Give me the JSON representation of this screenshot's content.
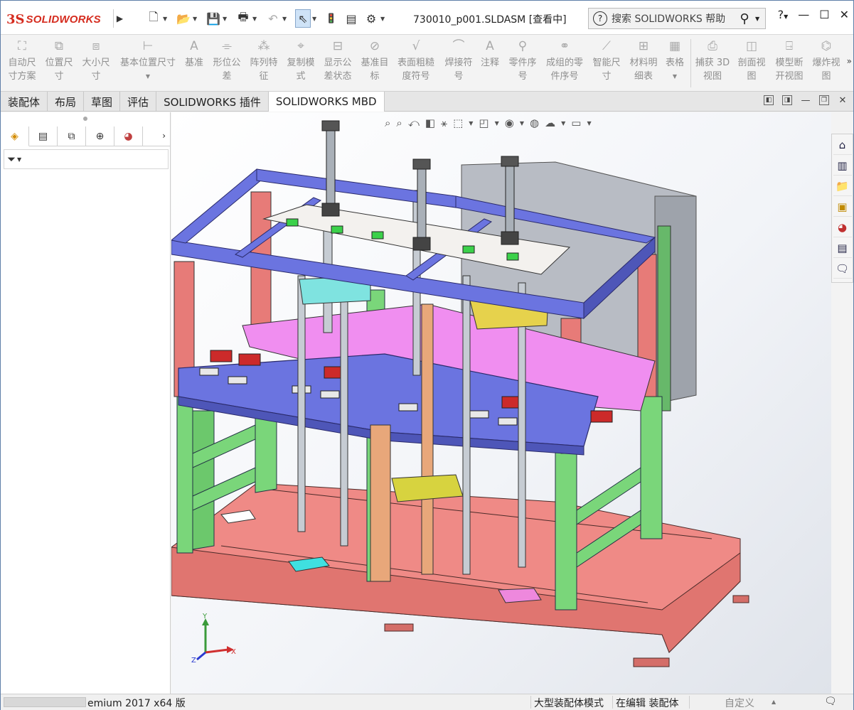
{
  "app": {
    "logo_ds": "3S",
    "logo_solid": "SOLID",
    "logo_works": "WORKS",
    "document_title": "730010_p001.SLDASM [查看中]",
    "search_placeholder": "搜索 SOLIDWORKS 帮助",
    "help_label": "?",
    "accent_color": "#d52b1e"
  },
  "quick_access": [
    {
      "name": "new-icon",
      "glyph": "🗋"
    },
    {
      "name": "open-icon",
      "glyph": "📂"
    },
    {
      "name": "save-icon",
      "glyph": "💾"
    },
    {
      "name": "print-icon",
      "glyph": "🖶"
    },
    {
      "name": "undo-icon",
      "glyph": "↶"
    },
    {
      "name": "select-icon",
      "glyph": "⇖"
    },
    {
      "name": "rebuild-icon",
      "glyph": "🚦"
    },
    {
      "name": "file-properties-icon",
      "glyph": "▤"
    },
    {
      "name": "options-icon",
      "glyph": "⚙"
    }
  ],
  "commands": [
    {
      "label": "自动尺\n寸方案",
      "icon": "auto-dimension-icon",
      "glyph": "⛶"
    },
    {
      "label": "位置尺\n寸",
      "icon": "location-dimension-icon",
      "glyph": "⧉"
    },
    {
      "label": "大小尺\n寸",
      "icon": "size-dimension-icon",
      "glyph": "⧈"
    },
    {
      "label": "基本位置尺寸",
      "icon": "basic-location-dimension-icon",
      "glyph": "⊢"
    },
    {
      "label": "基准",
      "icon": "datum-icon",
      "glyph": "A"
    },
    {
      "label": "形位公\n差",
      "icon": "geometric-tolerance-icon",
      "glyph": "⌯"
    },
    {
      "label": "阵列特\n征",
      "icon": "pattern-feature-icon",
      "glyph": "⁂"
    },
    {
      "label": "复制模\n式",
      "icon": "copy-scheme-icon",
      "glyph": "⌖"
    },
    {
      "label": "显示公\n差状态",
      "icon": "show-tolerance-status-icon",
      "glyph": "⊟"
    },
    {
      "label": "基准目\n标",
      "icon": "datum-target-icon",
      "glyph": "⊘"
    },
    {
      "label": "表面粗糙\n度符号",
      "icon": "surface-finish-icon",
      "glyph": "√"
    },
    {
      "label": "焊接符\n号",
      "icon": "weld-symbol-icon",
      "glyph": "⌒"
    },
    {
      "label": "注释",
      "icon": "note-icon",
      "glyph": "A"
    },
    {
      "label": "零件序\n号",
      "icon": "balloon-icon",
      "glyph": "⚲"
    },
    {
      "label": "成组的零\n件序号",
      "icon": "stacked-balloon-icon",
      "glyph": "⚭"
    },
    {
      "label": "智能尺\n寸",
      "icon": "smart-dimension-icon",
      "glyph": "⟋"
    },
    {
      "label": "材料明\n细表",
      "icon": "bom-icon",
      "glyph": "⊞"
    },
    {
      "label": "表格",
      "icon": "table-icon",
      "glyph": "▦"
    },
    {
      "label": "捕获 3D\n视图",
      "icon": "capture-3d-view-icon",
      "glyph": "⎙"
    },
    {
      "label": "剖面视\n图",
      "icon": "section-view-icon",
      "glyph": "◫"
    },
    {
      "label": "模型断\n开视图",
      "icon": "model-break-view-icon",
      "glyph": "⍈"
    },
    {
      "label": "爆炸视\n图",
      "icon": "exploded-view-icon",
      "glyph": "⌬"
    }
  ],
  "tabs": [
    {
      "label": "装配体",
      "active": false
    },
    {
      "label": "布局",
      "active": false
    },
    {
      "label": "草图",
      "active": false
    },
    {
      "label": "评估",
      "active": false
    },
    {
      "label": "SOLIDWORKS 插件",
      "active": false
    },
    {
      "label": "SOLIDWORKS MBD",
      "active": true
    }
  ],
  "left_panel": {
    "tabs": [
      {
        "name": "feature-manager-icon",
        "glyph": "◈"
      },
      {
        "name": "property-manager-icon",
        "glyph": "▤"
      },
      {
        "name": "configuration-manager-icon",
        "glyph": "⧉"
      },
      {
        "name": "dimxpert-manager-icon",
        "glyph": "⊕"
      },
      {
        "name": "display-manager-icon",
        "glyph": "◕"
      }
    ],
    "filter_glyph": "⏷"
  },
  "heads_up_toolbar": [
    {
      "name": "zoom-to-fit-icon",
      "glyph": "⌕"
    },
    {
      "name": "zoom-to-area-icon",
      "glyph": "⌕"
    },
    {
      "name": "previous-view-icon",
      "glyph": "⤺"
    },
    {
      "name": "section-view-icon",
      "glyph": "◧"
    },
    {
      "name": "dynamic-annotation-icon",
      "glyph": "⚹"
    },
    {
      "name": "view-orientation-icon",
      "glyph": "⬚"
    },
    {
      "name": "display-style-icon",
      "glyph": "◰"
    },
    {
      "name": "hide-show-items-icon",
      "glyph": "◉"
    },
    {
      "name": "edit-appearance-icon",
      "glyph": "◍"
    },
    {
      "name": "apply-scene-icon",
      "glyph": "☁"
    },
    {
      "name": "view-settings-icon",
      "glyph": "▭"
    }
  ],
  "task_pane": [
    {
      "name": "home-icon",
      "glyph": "⌂"
    },
    {
      "name": "design-library-icon",
      "glyph": "▥"
    },
    {
      "name": "file-explorer-icon",
      "glyph": "📁"
    },
    {
      "name": "view-palette-icon",
      "glyph": "▣"
    },
    {
      "name": "appearances-icon",
      "glyph": "◕"
    },
    {
      "name": "custom-properties-icon",
      "glyph": "▤"
    },
    {
      "name": "forum-icon",
      "glyph": "🗨"
    }
  ],
  "triad": {
    "x": "X",
    "y": "Y",
    "z": "Z"
  },
  "status_bar": {
    "version": "emium 2017 x64 版",
    "mode": "大型装配体模式",
    "edit_state": "在编辑 装配体",
    "units": "自定义"
  }
}
